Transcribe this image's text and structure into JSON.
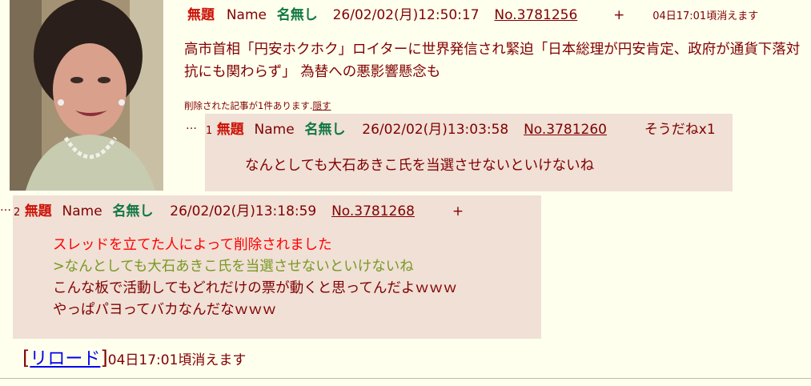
{
  "op": {
    "subject": "無題",
    "name_label": "Name",
    "name": "名無し",
    "datetime": "26/02/02(月)12:50:17",
    "no": "No.3781256",
    "plus": "+",
    "expire": "04日17:01頃消えます",
    "body": "高市首相「円安ホクホク」ロイターに世界発信され緊迫「日本総理が円安肯定、政府が通貨下落対抗にも関わらず」 為替への悪影響懸念も",
    "deleted_note": "削除された記事が1件あります.",
    "hide_link": "隠す"
  },
  "replies": [
    {
      "dots": "…",
      "num": "1",
      "subject": "無題",
      "name_label": "Name",
      "name": "名無し",
      "datetime": "26/02/02(月)13:03:58",
      "no": "No.3781260",
      "sodane": "そうだねx1",
      "lines": [
        "なんとしても大石あきこ氏を当選させないといけないね"
      ]
    },
    {
      "dots": "…",
      "num": "2",
      "subject": "無題",
      "name_label": "Name",
      "name": "名無し",
      "datetime": "26/02/02(月)13:18:59",
      "no": "No.3781268",
      "plus": "+",
      "lines": [
        "スレッドを立てた人によって削除されました",
        ">なんとしても大石あきこ氏を当選させないといけないね",
        "こんな板で活動してもどれだけの票が動くと思ってんだよｗｗｗ",
        "やっぱパヨってバカなんだなｗｗｗ"
      ]
    }
  ],
  "footer": {
    "open_bracket": "[",
    "reload": "リロード",
    "close_bracket": "]",
    "expire": "04日17:01頃消えます"
  }
}
